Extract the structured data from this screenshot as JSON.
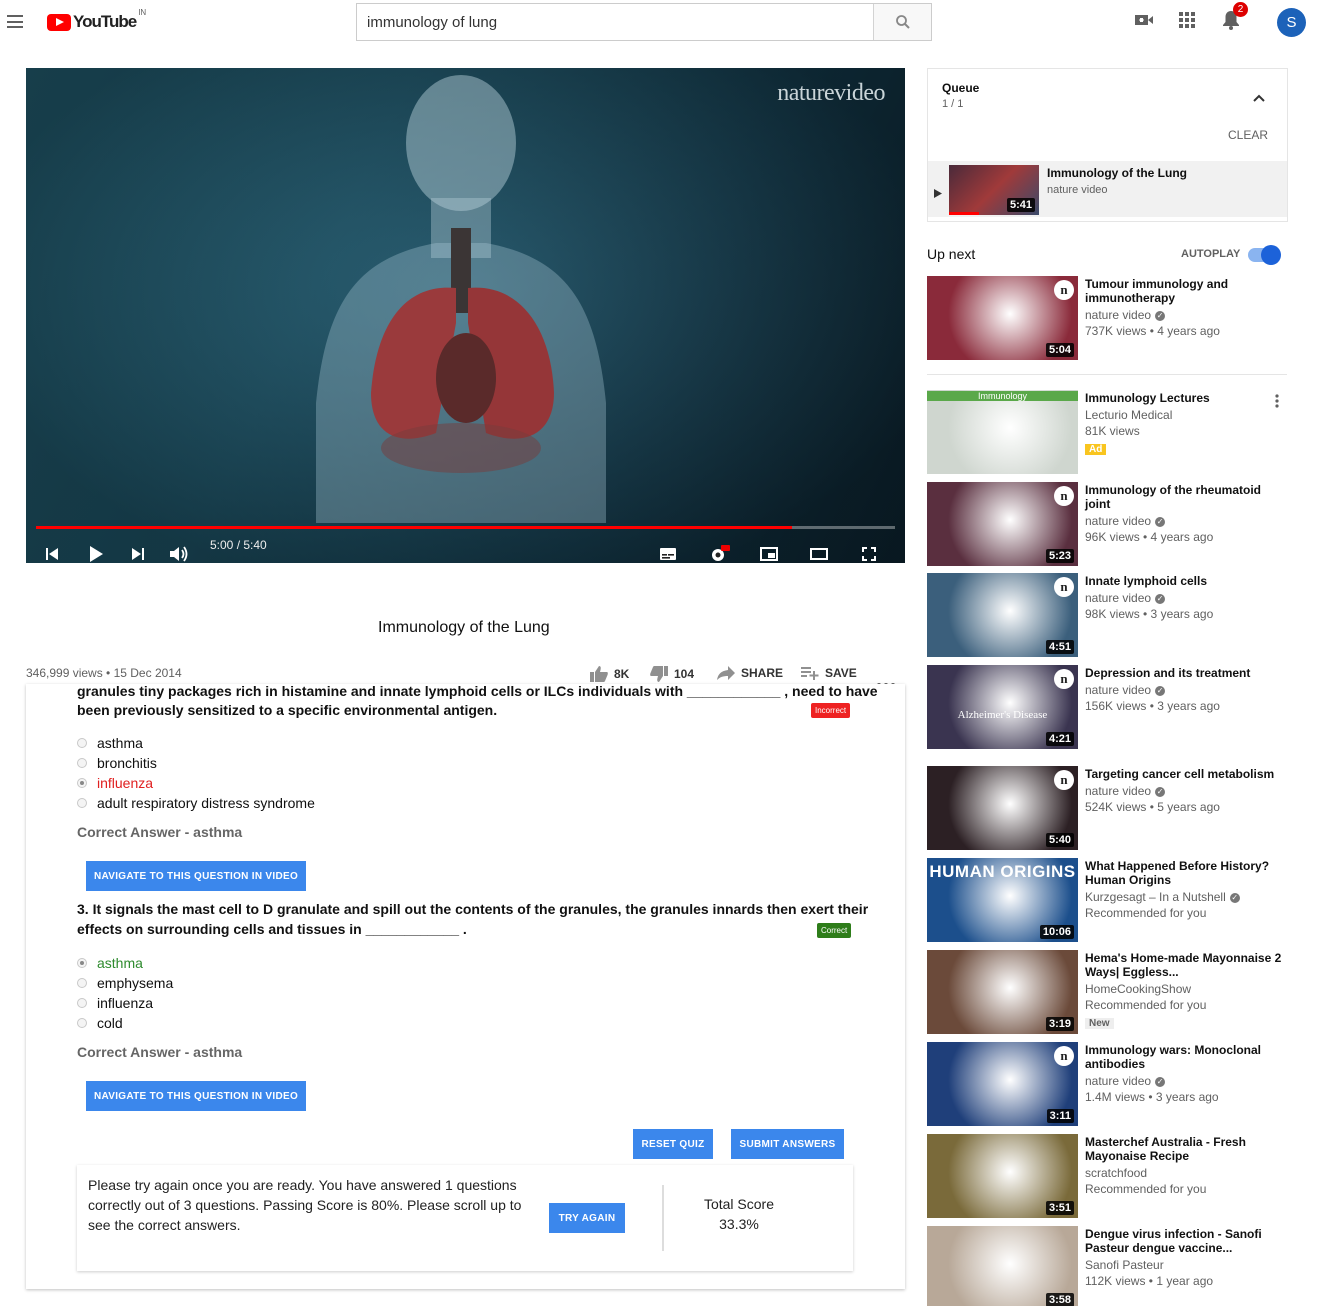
{
  "header": {
    "logo_text": "YouTube",
    "region": "IN",
    "search_value": "immunology of lung",
    "notification_count": "2",
    "avatar_letter": "S"
  },
  "player": {
    "watermark": "naturevideo",
    "time": "5:00 / 5:40",
    "progress_fraction": 0.88
  },
  "video": {
    "title": "Immunology of the Lung",
    "views_date": "346,999 views • 15 Dec 2014",
    "likes": "8K",
    "dislikes": "104",
    "share": "SHARE",
    "save": "SAVE"
  },
  "quiz": {
    "q2_text_line1": "granules tiny packages rich in histamine and innate lymphoid cells or ILCs individuals with ____________ , need to have",
    "q2_text_line2": "been previously sensitized to a specific environmental antigen.",
    "q2_tag": "Incorrect",
    "q2_options": [
      "asthma",
      "bronchitis",
      "influenza",
      "adult respiratory distress syndrome"
    ],
    "q2_correct": "Correct Answer - asthma",
    "navigate": "NAVIGATE TO THIS QUESTION IN VIDEO",
    "q3_text_line1": "3. It signals the mast cell to D granulate and spill out the contents of the granules, the granules innards then exert their",
    "q3_text_line2": "effects on surrounding cells and tissues in ____________ .",
    "q3_tag": "Correct",
    "q3_options": [
      "asthma",
      "emphysema",
      "influenza",
      "cold"
    ],
    "q3_correct": "Correct Answer - asthma",
    "reset": "RESET QUIZ",
    "submit": "SUBMIT ANSWERS",
    "result_msg": "Please try again once you are ready. You have answered 1 questions correctly out of 3 questions. Passing Score is 80%. Please scroll up to see the correct answers.",
    "try_again": "TRY AGAIN",
    "total_label": "Total Score",
    "total_value": "33.3%"
  },
  "queue": {
    "title": "Queue",
    "count": "1 / 1",
    "clear": "CLEAR",
    "item_title": "Immunology of the Lung",
    "item_channel": "nature video",
    "item_duration": "5:41"
  },
  "upnext": {
    "label": "Up next",
    "autoplay": "AUTOPLAY"
  },
  "videos": [
    {
      "title": "Tumour immunology and immunotherapy",
      "channel": "nature video",
      "views": "737K views • 4 years ago",
      "duration": "5:04",
      "bg": "#8a2a3a"
    },
    {
      "title": "Immunology Lectures",
      "channel": "Lecturio Medical",
      "views": "81K views",
      "badge": "Ad",
      "bg": "#cfd6cf",
      "overlay": "Immunology"
    },
    {
      "title": "Immunology of the rheumatoid joint",
      "channel": "nature video",
      "views": "96K views • 4 years ago",
      "duration": "5:23",
      "bg": "#5a2f3f"
    },
    {
      "title": "Innate lymphoid cells",
      "channel": "nature video",
      "views": "98K views • 3 years ago",
      "duration": "4:51",
      "bg": "#3b5f7c"
    },
    {
      "title": "Depression and its treatment",
      "channel": "nature video",
      "views": "156K views • 3 years ago",
      "duration": "4:21",
      "bg": "#3a3450",
      "overlay": "Alzheimer's Disease"
    },
    {
      "title": "Targeting cancer cell metabolism",
      "channel": "nature video",
      "views": "524K views • 5 years ago",
      "duration": "5:40",
      "bg": "#2c2024"
    },
    {
      "title": "What Happened Before History? Human Origins",
      "channel": "Kurzgesagt – In a Nutshell",
      "views": "Recommended for you",
      "duration": "10:06",
      "bg": "#1c4f8c",
      "overlay": "HUMAN ORIGINS"
    },
    {
      "title": "Hema's Home-made Mayonnaise 2 Ways| Eggless...",
      "channel": "HomeCookingShow",
      "views": "Recommended for you",
      "badge": "New",
      "duration": "3:19",
      "bg": "#6b4a3a"
    },
    {
      "title": "Immunology wars: Monoclonal antibodies",
      "channel": "nature video",
      "views": "1.4M views • 3 years ago",
      "duration": "3:11",
      "bg": "#1f3f7a"
    },
    {
      "title": "Masterchef Australia - Fresh Mayonaise Recipe",
      "channel": "scratchfood",
      "views": "Recommended for you",
      "duration": "3:51",
      "bg": "#7a6a3a"
    },
    {
      "title": "Dengue virus infection - Sanofi Pasteur dengue vaccine...",
      "channel": "Sanofi Pasteur",
      "views": "112K views • 1 year ago",
      "duration": "3:58",
      "bg": "#b8a898"
    }
  ]
}
